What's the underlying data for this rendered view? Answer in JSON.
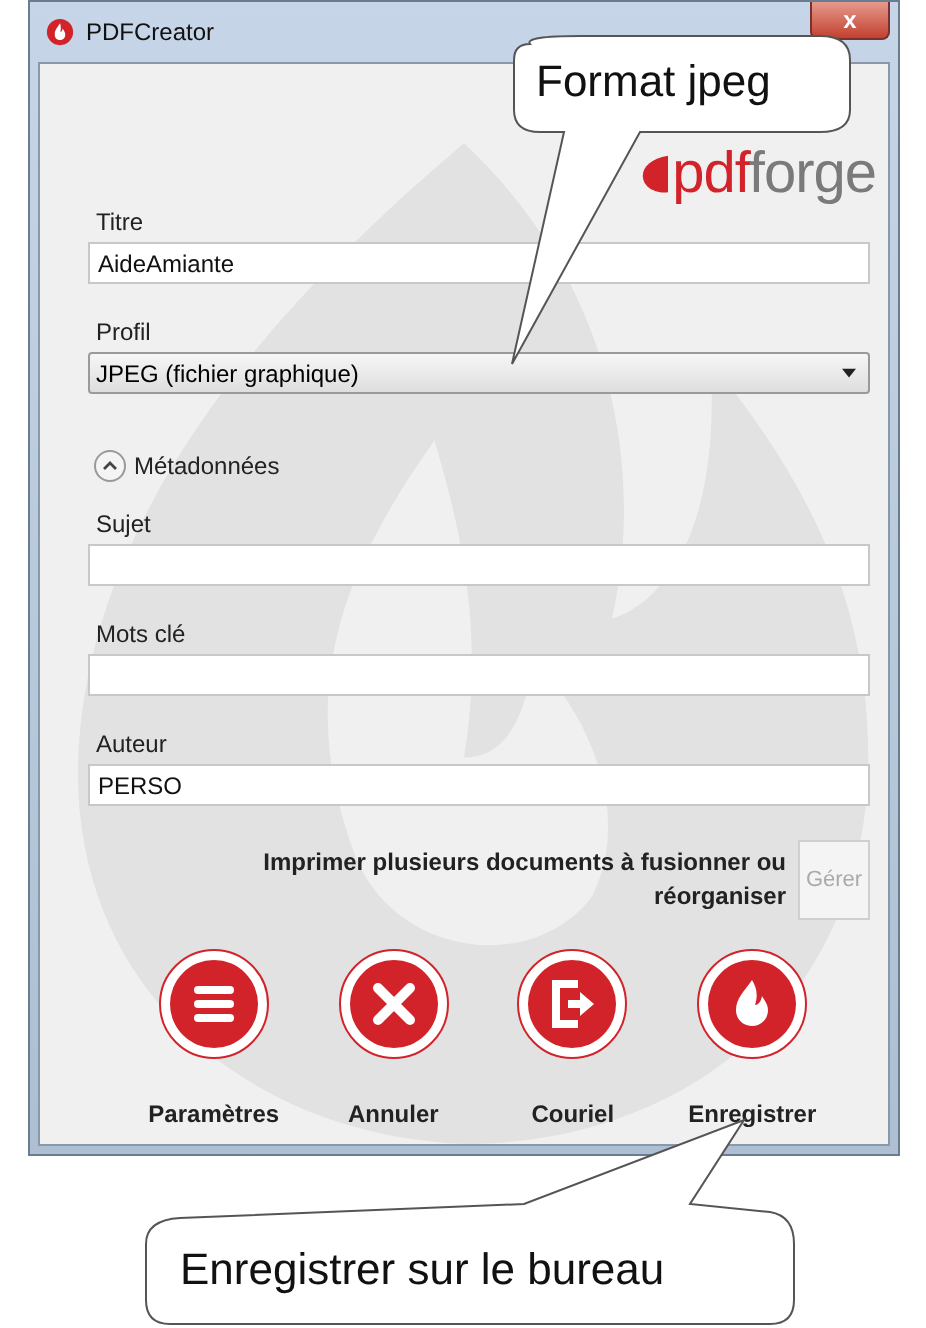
{
  "window": {
    "title": "PDFCreator",
    "close": "x"
  },
  "logo": {
    "accent": "pdf",
    "rest": "forge"
  },
  "fields": [
    {
      "kind": "text",
      "label": "Titre",
      "value": "AideAmiante"
    },
    {
      "kind": "dropdown",
      "label": "Profil",
      "value": "JPEG (fichier graphique)"
    }
  ],
  "metadata": {
    "label": "Métadonnées",
    "expanded": true,
    "fields": [
      {
        "label": "Sujet"
      },
      {
        "label": "Mots clé"
      },
      {
        "label": "Auteur",
        "value": "PERSO"
      }
    ]
  },
  "merge": {
    "text": "Imprimer plusieurs documents à fusionner ou réorganiser",
    "button": "Gérer",
    "disabled": true
  },
  "actions": [
    {
      "kind": "settings",
      "label": "Paramètres"
    },
    {
      "kind": "cancel",
      "label": "Annuler"
    },
    {
      "kind": "email",
      "label": "Couriel"
    },
    {
      "kind": "save",
      "label": "Enregistrer"
    }
  ],
  "callouts": [
    {
      "kind": "top",
      "text": "Format jpeg"
    },
    {
      "kind": "bottom",
      "text": "Enregistrer sur le bureau"
    }
  ]
}
